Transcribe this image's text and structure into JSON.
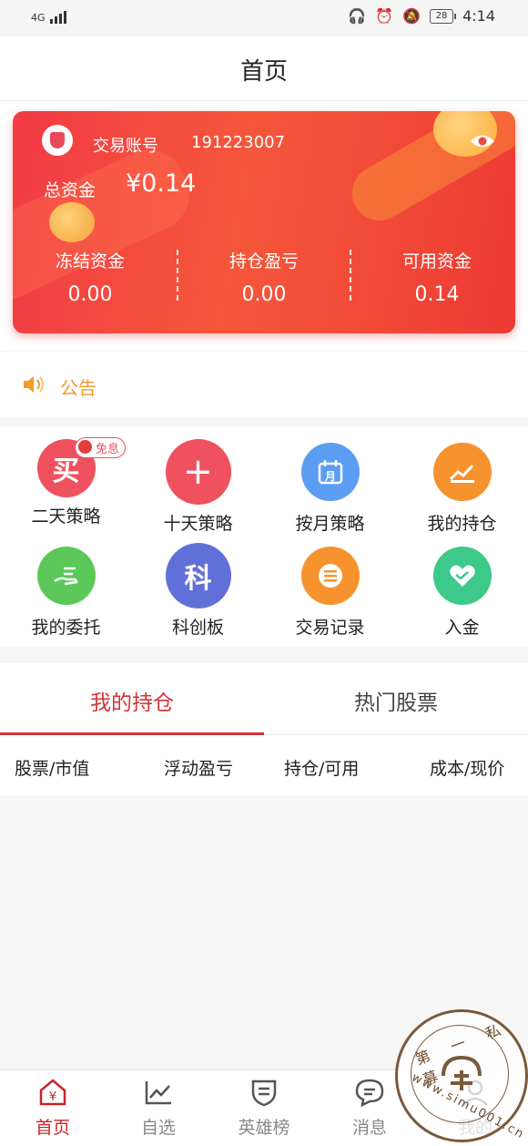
{
  "status_bar": {
    "network": "4G",
    "time": "4:14",
    "battery": "28"
  },
  "header": {
    "title": "首页"
  },
  "account": {
    "label": "交易账号",
    "number": "191223007",
    "total_label": "总资金",
    "total_value": "¥0.14",
    "stats": [
      {
        "label": "冻结资金",
        "value": "0.00"
      },
      {
        "label": "持仓盈亏",
        "value": "0.00"
      },
      {
        "label": "可用资金",
        "value": "0.14"
      }
    ]
  },
  "notice": {
    "label": "公告"
  },
  "shortcuts": [
    {
      "label": "二天策略",
      "glyph": "买",
      "color": "#f0515e",
      "badge": "免息"
    },
    {
      "label": "十天策略",
      "glyph": "+",
      "color": "#f0515e"
    },
    {
      "label": "按月策略",
      "glyph": "月",
      "color": "#5a9df2"
    },
    {
      "label": "我的持仓",
      "glyph": "chart",
      "color": "#f6932f"
    },
    {
      "label": "我的委托",
      "glyph": "hand",
      "color": "#5cc85a"
    },
    {
      "label": "科创板",
      "glyph": "科",
      "color": "#6170d8"
    },
    {
      "label": "交易记录",
      "glyph": "list",
      "color": "#f6932f"
    },
    {
      "label": "入金",
      "glyph": "heart",
      "color": "#3cc98a"
    }
  ],
  "tabs": [
    {
      "label": "我的持仓"
    },
    {
      "label": "热门股票"
    }
  ],
  "columns": [
    "股票/市值",
    "浮动盈亏",
    "持仓/可用",
    "成本/现价"
  ],
  "tabbar": [
    {
      "label": "首页",
      "icon": "home-yen-icon"
    },
    {
      "label": "自选",
      "icon": "line-chart-icon"
    },
    {
      "label": "英雄榜",
      "icon": "shield-list-icon"
    },
    {
      "label": "消息",
      "icon": "message-icon"
    },
    {
      "label": "我的",
      "icon": "user-icon"
    }
  ],
  "watermark": {
    "top": "第 一 私 募",
    "bottom": "www.simu001.cn"
  },
  "colors": {
    "accent": "#d3333a",
    "card": "#f2473f",
    "notice": "#f19a2a"
  }
}
